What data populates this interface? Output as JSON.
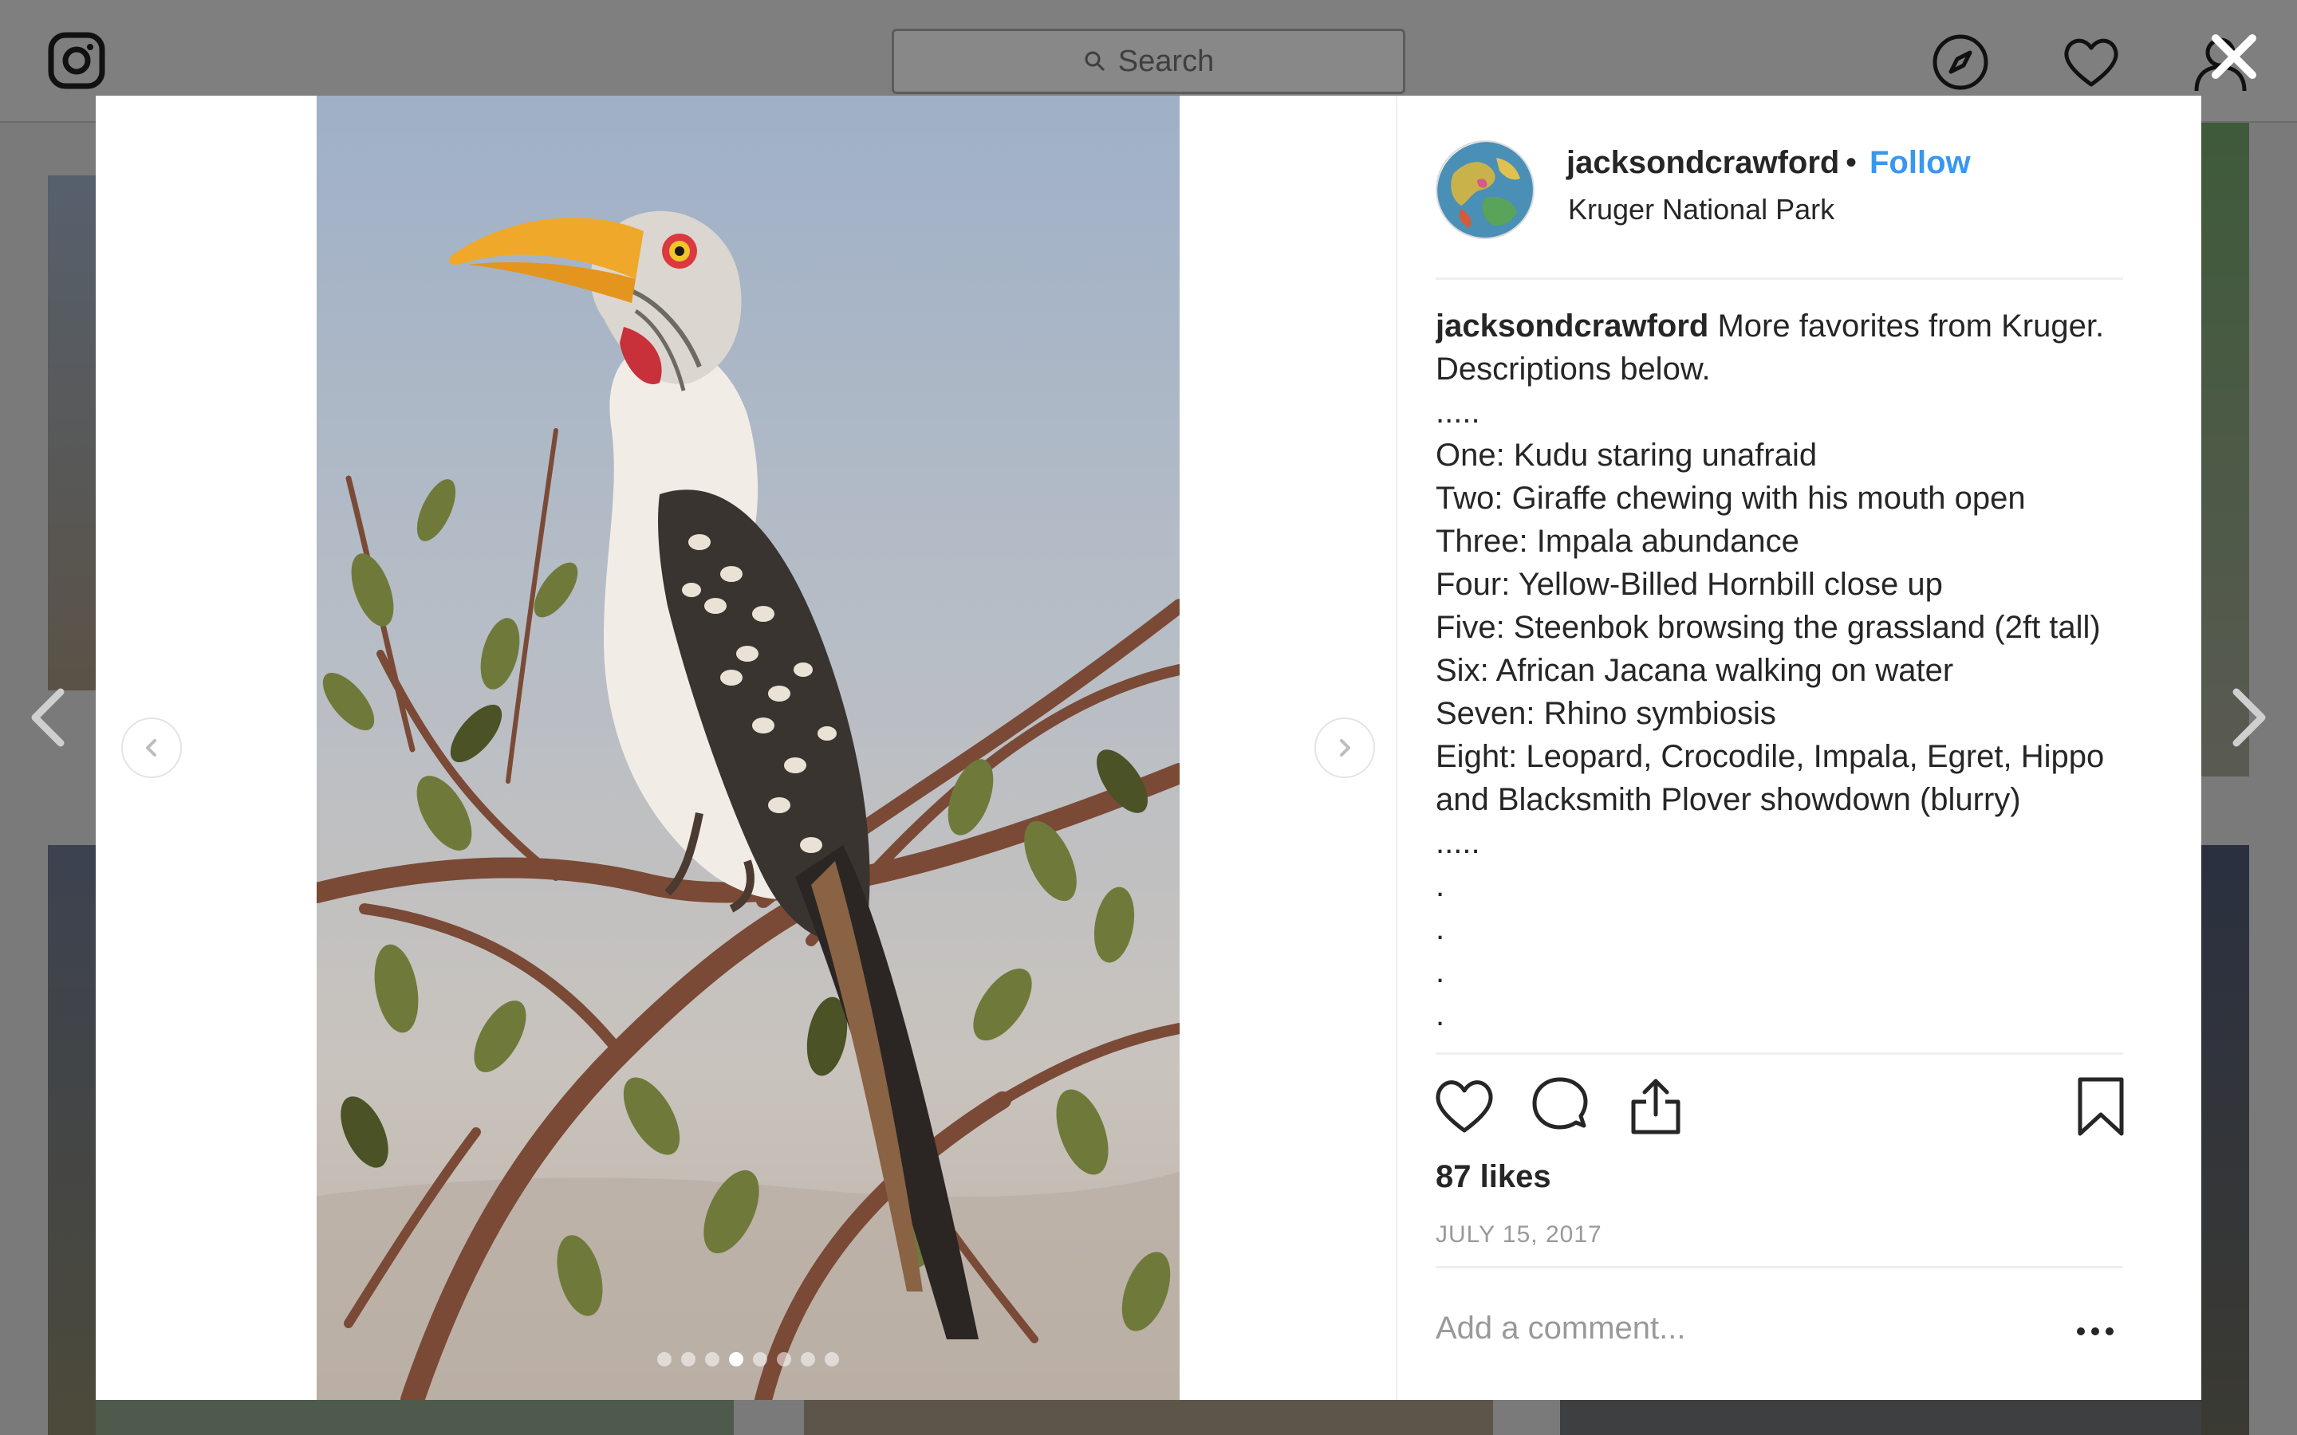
{
  "header": {
    "search_placeholder": "Search"
  },
  "post": {
    "username": "jacksondcrawford",
    "follow_label": "Follow",
    "separator": "•",
    "location": "Kruger National Park",
    "caption_intro": "More favorites from Kruger. Descriptions below.",
    "caption_lines": [
      ".....",
      "One: Kudu staring unafraid",
      "Two: Giraffe chewing with his mouth open",
      "Three: Impala abundance",
      "Four: Yellow-Billed Hornbill close up",
      "Five: Steenbok browsing the grassland (2ft tall)",
      "Six: African Jacana walking on water",
      "Seven: Rhino symbiosis",
      "Eight: Leopard, Crocodile, Impala, Egret, Hippo and Blacksmith Plover showdown (blurry)",
      ".....",
      ".",
      ".",
      ".",
      "."
    ],
    "likes_label": "87 likes",
    "date": "JULY 15, 2017",
    "comment_placeholder": "Add a comment...",
    "carousel": {
      "total_slides": 8,
      "active_slide": 4
    }
  },
  "icons": {
    "logo": "instagram-logo-icon",
    "search": "search-icon",
    "explore": "compass-icon",
    "activity": "heart-icon",
    "profile": "user-icon",
    "close": "close-icon",
    "like": "heart-icon",
    "comment": "comment-icon",
    "share": "share-icon",
    "save": "bookmark-icon",
    "more": "more-options-icon"
  },
  "colors": {
    "follow": "#3897f0",
    "text": "#262626",
    "muted": "#999999",
    "overlay": "#7a7a7a"
  }
}
